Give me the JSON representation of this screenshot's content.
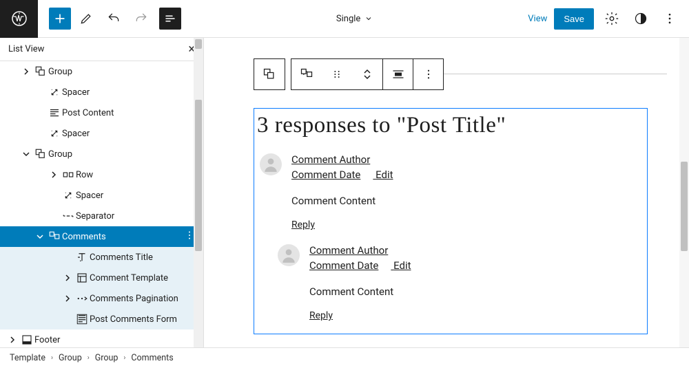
{
  "topbar": {
    "template_name": "Single",
    "view_label": "View",
    "save_label": "Save"
  },
  "listview": {
    "title": "List View",
    "items": [
      {
        "label": "Group",
        "indent": 28,
        "caret": "right",
        "icon": "group"
      },
      {
        "label": "Spacer",
        "indent": 48,
        "caret": "",
        "icon": "spacer"
      },
      {
        "label": "Post Content",
        "indent": 48,
        "caret": "",
        "icon": "postcontent"
      },
      {
        "label": "Spacer",
        "indent": 48,
        "caret": "",
        "icon": "spacer"
      },
      {
        "label": "Group",
        "indent": 28,
        "caret": "down",
        "icon": "group"
      },
      {
        "label": "Row",
        "indent": 68,
        "caret": "right",
        "icon": "row"
      },
      {
        "label": "Spacer",
        "indent": 68,
        "caret": "",
        "icon": "spacer"
      },
      {
        "label": "Separator",
        "indent": 68,
        "caret": "",
        "icon": "separator"
      },
      {
        "label": "Comments",
        "indent": 48,
        "caret": "down",
        "icon": "comments",
        "selected": true
      },
      {
        "label": "Comments Title",
        "indent": 88,
        "caret": "",
        "icon": "commentstitle",
        "sub": true
      },
      {
        "label": "Comment Template",
        "indent": 88,
        "caret": "right",
        "icon": "template",
        "sub": true
      },
      {
        "label": "Comments Pagination",
        "indent": 88,
        "caret": "right",
        "icon": "pagination",
        "sub": true
      },
      {
        "label": "Post Comments Form",
        "indent": 88,
        "caret": "",
        "icon": "form",
        "sub": true
      },
      {
        "label": "Footer",
        "indent": 8,
        "caret": "right",
        "icon": "footer"
      }
    ]
  },
  "canvas": {
    "comments_heading": "3 responses to \"Post Title\"",
    "comment": {
      "author_label": "Comment Author",
      "date_label": "Comment Date",
      "edit_label": "Edit",
      "content_label": "Comment Content",
      "reply_label": "Reply"
    }
  },
  "breadcrumb": [
    "Template",
    "Group",
    "Group",
    "Comments"
  ]
}
